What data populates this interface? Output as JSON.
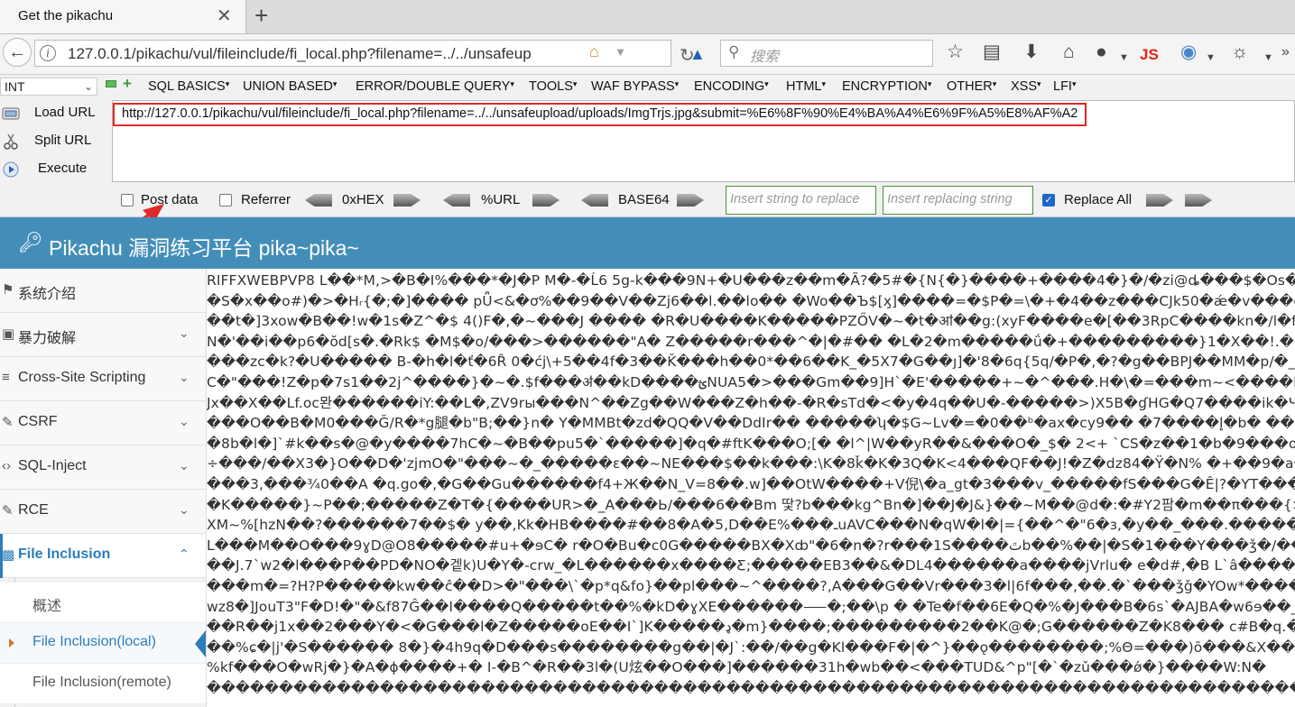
{
  "browser": {
    "tab_title": "Get the pikachu",
    "tab_close": "✕",
    "new_tab": "+",
    "address": "127.0.0.1/pikachu/vul/fileinclude/fi_local.php?filename=../../unsafeup",
    "search_placeholder": "搜索",
    "icons": [
      "back-arrow-icon",
      "info-icon",
      "home-icon",
      "reload-icon",
      "search-icon",
      "star-icon",
      "reading-list-icon",
      "download-icon",
      "home-icon",
      "globe-icon",
      "js-icon",
      "firebug-icon",
      "palette-icon",
      "menu-overflow-icon"
    ],
    "js_label": "JS"
  },
  "hackbar": {
    "type_select": "INT",
    "menu": [
      "SQL BASICS",
      "UNION BASED",
      "ERROR/DOUBLE QUERY",
      "TOOLS",
      "WAF BYPASS",
      "ENCODING",
      "HTML",
      "ENCRYPTION",
      "OTHER",
      "XSS",
      "LFI"
    ],
    "actions": {
      "load_url": "Load URL",
      "split_url": "Split URL",
      "execute": "Execute"
    },
    "url_value": "http://127.0.0.1/pikachu/vul/fileinclude/fi_local.php?filename=../../unsafeupload/uploads/ImgTrjs.jpg&submit=%E6%8F%90%E4%BA%A4%E6%9F%A5%E8%AF%A2",
    "options": {
      "post_data": "Post data",
      "referrer": "Referrer",
      "hex": "0xHEX",
      "url": "%URL",
      "base64": "BASE64",
      "replace_find_placeholder": "Insert string to replace",
      "replace_with_placeholder": "Insert replacing string",
      "replace_all": "Replace All",
      "post_data_checked": false,
      "referrer_checked": false,
      "replace_all_checked": true
    }
  },
  "site": {
    "title": "Pikachu 漏洞练习平台 pika~pika~",
    "nav": [
      {
        "label": "系统介绍",
        "icon": "tag-icon",
        "expandable": false
      },
      {
        "label": "暴力破解",
        "icon": "lock-icon",
        "expandable": true
      },
      {
        "label": "Cross-Site Scripting",
        "icon": "list-icon",
        "expandable": true
      },
      {
        "label": "CSRF",
        "icon": "edit-icon",
        "expandable": true
      },
      {
        "label": "SQL-Inject",
        "icon": "code-icon",
        "expandable": true
      },
      {
        "label": "RCE",
        "icon": "edit-icon",
        "expandable": true
      },
      {
        "label": "File Inclusion",
        "icon": "file-icon",
        "expandable": true
      }
    ],
    "subnav": [
      {
        "label": "概述"
      },
      {
        "label": "File Inclusion(local)"
      },
      {
        "label": "File Inclusion(remote)"
      }
    ],
    "content_lines": [
      "RIFFXWEBPVP8 L��*M,>�B�I%���*�J�P M�-�Ĺ6 5g-k���9N+�U���z��m�Ã?�5#�{N{�}����+����4�}�/�zi@ȡ���$�Os���������",
      "�S�x��o#)�>�Hᵣ{�;�]���� pǕ<&�ơ%��9��V��Zj6��l.��lo�� �Wo��Ъ$[ӽ]����=�$P�=\\�+�4��z���CJk50�ǽ�v���ey_ �3�������",
      "��t�]3xow�B��!w�1s�Z^�$ 4()F�,�~���J ���� �R�U����K�����PZŐV�~�t�ॴ��g:(xyF����e�[��3RpC����kn�/l�f��JUP�",
      "N�'��i��p6�ŏd[s�.�Rk$ �M$�o/���>������\"A� Z�����r���^�|�#�� �L�2�m�����ǘ�+���������}1�X��!.�K_j�F�~�",
      "���zc�k?�U����� B-�h�l�ť�6Ȓ 0�ćj\\+5��4f�3��Ǩ���h��0*��6��K_�5X7�G��ȷ]�'8�6q{5q/�P�,�?�g��BPJ��MM�p/�_64�U@",
      "C�\"���!Z�p�7s1��2j^����}�~�.$f���ॳ��kD����ؿNUA5�>���Gm��9]H`�E'�����+~�^���.H�\\�=���m~<����P>�Ɛ����",
      "Jx��X��Lf.oc뫈������iY:��L�,ZV9rы���N^��Zg��W���Z�h��-�R�sTd�<�y�4q��U�-�����>)X5B�ɠHG�Q7����ik�Ч�",
      "���O��B�M0���Ğ/R�*g腿�b\"B;��}n� Y�MMBt�zd�QQ�V��DdIr�� �����ʮ�$G~Lv�=�0��ᵇ�ax�cy9�� �7����l̥�b� ���[k",
      "�8b�l�]`#k��s�@�y����7hC�~�B��pu5�`�����]�q�#ftK���O;[� �l^|W��yR��&���O�_$� 2<+ `CS�z��1�b�9���oSq",
      "÷���/��X3�}O��D�'zjmO�\"���~�_�����ɛ��~NE���$��k���:\\K�8ǩ�K�3Q�K<4���QF��J!�Z�dz84�Ϋ�N% �+��9�a�E���",
      "���3,���¾0��A �q.go�,�G��Gu������f4+Ж��N_V=8��.w]��OtW����+V倪\\�a_gt�3���v_�����fS���G�Ê|?�YT����HIU",
      "�K�����}~P��;�����Z�T�{����UR>�_A���Ь/���6��Bm 땇?b���kg^Bn�]��J�J&}��~M��@d�:�#Y2팜�m��π���{>�>]��ҫE",
      "XM~%[hzN��?������7��$� y��,Kk�HB����#��8�A�5,D��E%���ـuAVC���N�qW�l�|={��^�\"6�ɜ,�y��_���.�����/����#",
      "L���M��O���9ɣD@O8�����#u+�ɘC� r�O�Bu�c0G�����BX�Xȸ\"�6�n�?r���1S����ٿb��%��|�S�1���Y���ǯ�/����cA",
      "��J.7`w2�l���P��PD�NO�겥k)U�Y�-crw_�L������x����Ƹ;�����EB3��&�DL4������a����jVrlu� e�d#,�B L`â����c8",
      "���m�=?H?P�����kw��ĉ��D>�\"���\\`�p*q&fo}��pl���~^����?,A���G��Vr���3�l|6f���,��.�`���ǯǧ�YOw*����0&��",
      "wz8�]JouT3\"F�D!�\"�&f87Ĝ��I����Q�����t��%�kD�ɣXE������⸺�;��\\p � �Te�f��6E�Q�%�J���B�6s`�AJBA�w6ɘ��_$r����",
      "��R��j1x��2���Y�<�G���l�Z�����oE��I`]K�����ډ�m}����;���������2��K@�;G������Z�K8��� c#B�q.��",
      "��%ɕ�|j'�S������ 8�}�4h9q�D���s��������g��|�J`:��/��g�Kl���F�|�^}��ǫ��������;%Θ=���)ō���&X���R�&�",
      "%kf���O�wRj�}�A�ɸ����+� I-�B^�R��3l�(U炫��O���]������31h�wb��<���TUD&^p\"[�`�zǔ���ǿ�}����W:N�",
      "���������������������������������������������������������������������������������������������������������"
    ]
  }
}
